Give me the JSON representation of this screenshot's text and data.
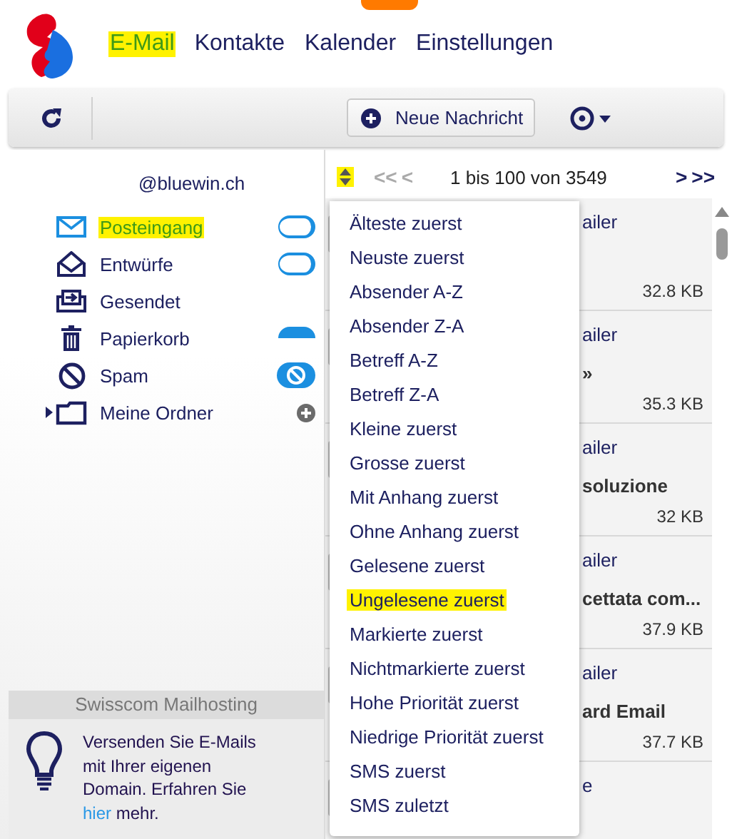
{
  "nav": [
    {
      "label": "E-Mail",
      "selected": true,
      "highlighted": true
    },
    {
      "label": "Kontakte",
      "selected": false,
      "highlighted": false
    },
    {
      "label": "Kalender",
      "selected": false,
      "highlighted": false
    },
    {
      "label": "Einstellungen",
      "selected": false,
      "highlighted": false
    }
  ],
  "toolbar": {
    "new_message": "Neue Nachricht"
  },
  "account": "@bluewin.ch",
  "folders": [
    {
      "label": "Posteingang",
      "kind": "inbox",
      "selected": true,
      "highlighted": true
    },
    {
      "label": "Entwürfe",
      "kind": "drafts",
      "selected": false,
      "highlighted": false
    },
    {
      "label": "Gesendet",
      "kind": "sent",
      "selected": false,
      "highlighted": false
    },
    {
      "label": "Papierkorb",
      "kind": "trash",
      "selected": false,
      "highlighted": false
    },
    {
      "label": "Spam",
      "kind": "spam",
      "selected": false,
      "highlighted": false
    },
    {
      "label": "Meine Ordner",
      "kind": "folder",
      "selected": false,
      "highlighted": false,
      "expandable": true
    }
  ],
  "pager": {
    "sort_highlighted": true,
    "range": "1 bis 100 von 3549",
    "back": [
      {
        "label": "<<",
        "disabled": true
      },
      {
        "label": "<",
        "disabled": true
      }
    ],
    "forward": [
      {
        "label": ">",
        "disabled": false
      },
      {
        "label": ">>",
        "disabled": false
      }
    ]
  },
  "messages": [
    {
      "sender": "ailer",
      "size": "32.8 KB"
    },
    {
      "sender": "ailer",
      "subject": "»",
      "size": "35.3 KB"
    },
    {
      "sender": "ailer",
      "subject": "soluzione",
      "size": "32 KB"
    },
    {
      "sender": "ailer",
      "subject": "cettata com...",
      "size": "37.9 KB"
    },
    {
      "sender": "ailer",
      "subject": "ard Email",
      "size": "37.7 KB"
    },
    {
      "sender": "e"
    }
  ],
  "sort_menu": [
    {
      "label": "Älteste zuerst",
      "highlighted": false
    },
    {
      "label": "Neuste zuerst",
      "highlighted": false
    },
    {
      "label": "Absender A-Z",
      "highlighted": false
    },
    {
      "label": "Absender Z-A",
      "highlighted": false
    },
    {
      "label": "Betreff A-Z",
      "highlighted": false
    },
    {
      "label": "Betreff Z-A",
      "highlighted": false
    },
    {
      "label": "Kleine zuerst",
      "highlighted": false
    },
    {
      "label": "Grosse zuerst",
      "highlighted": false
    },
    {
      "label": "Mit Anhang zuerst",
      "highlighted": false
    },
    {
      "label": "Ohne Anhang zuerst",
      "highlighted": false
    },
    {
      "label": "Gelesene zuerst",
      "highlighted": false
    },
    {
      "label": "Ungelesene zuerst",
      "highlighted": true
    },
    {
      "label": "Markierte zuerst",
      "highlighted": false
    },
    {
      "label": "Nichtmarkierte zuerst",
      "highlighted": false
    },
    {
      "label": "Hohe Priorität zuerst",
      "highlighted": false
    },
    {
      "label": "Niedrige Priorität zuerst",
      "highlighted": false
    },
    {
      "label": "SMS zuerst",
      "highlighted": false
    },
    {
      "label": "SMS zuletzt",
      "highlighted": false
    }
  ],
  "promo": {
    "title": "Swisscom Mailhosting",
    "text_before": "Versenden Sie E-Mails mit Ihrer eigenen Domain. Erfahren Sie ",
    "link": "hier",
    "text_after": " mehr."
  }
}
